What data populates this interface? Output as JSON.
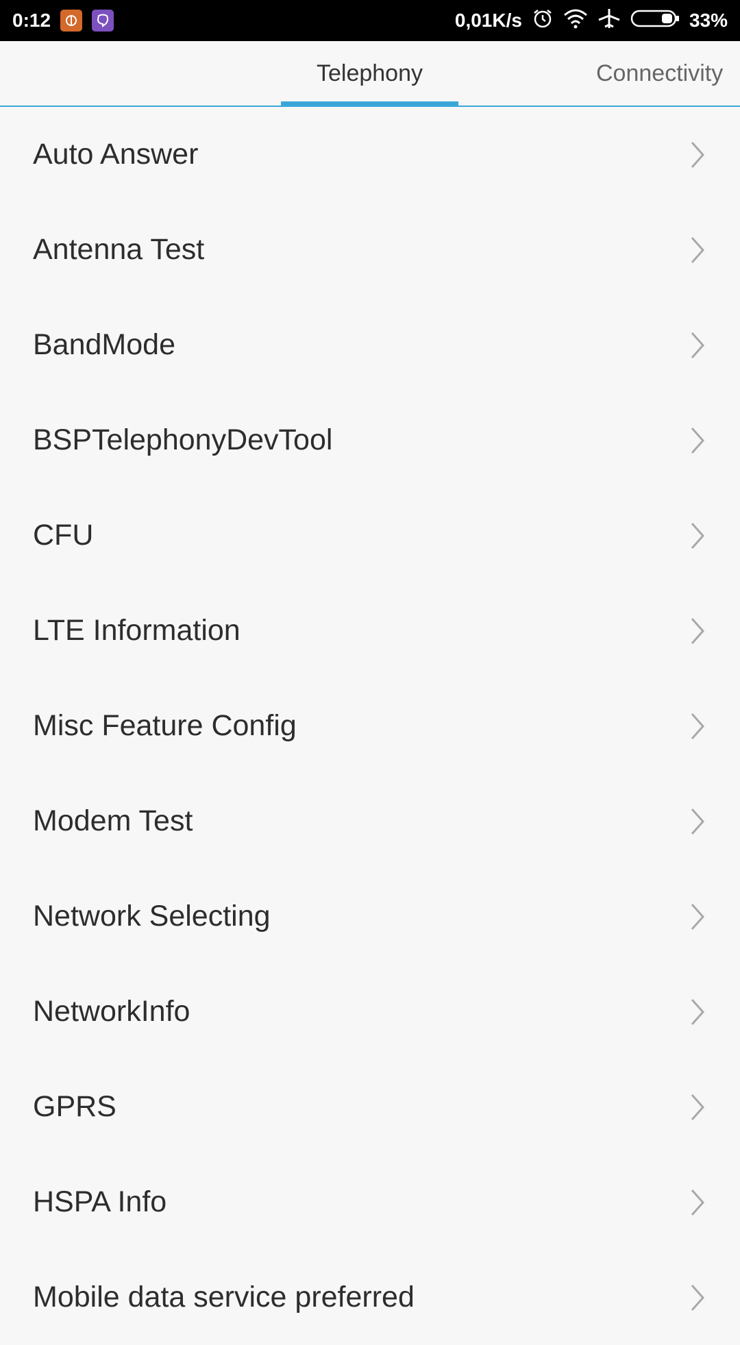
{
  "status": {
    "time": "0:12",
    "net_speed": "0,01K/s",
    "battery": "33%"
  },
  "tabs": [
    {
      "label": "Telephony",
      "active": true
    },
    {
      "label": "Connectivity",
      "active": false
    }
  ],
  "items": [
    {
      "label": "Auto Answer"
    },
    {
      "label": "Antenna Test"
    },
    {
      "label": "BandMode"
    },
    {
      "label": "BSPTelephonyDevTool"
    },
    {
      "label": "CFU"
    },
    {
      "label": "LTE Information"
    },
    {
      "label": "Misc Feature Config"
    },
    {
      "label": "Modem Test"
    },
    {
      "label": "Network Selecting"
    },
    {
      "label": "NetworkInfo"
    },
    {
      "label": "GPRS"
    },
    {
      "label": "HSPA Info"
    },
    {
      "label": "Mobile data service preferred"
    }
  ],
  "colors": {
    "accent": "#3aa6d8",
    "background": "#f7f7f7"
  }
}
